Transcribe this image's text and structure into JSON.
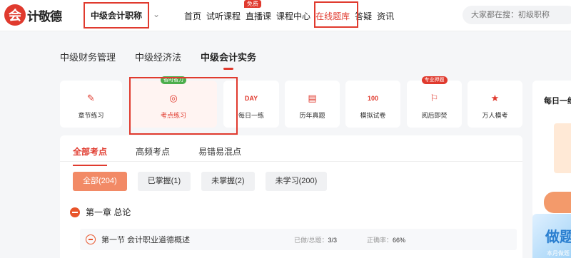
{
  "logo": {
    "mark": "会",
    "text": "计敬德"
  },
  "header": {
    "exam_select": "中级会计职称",
    "nav": [
      "首页",
      "试听课程",
      "直播课",
      "课程中心",
      "在线题库",
      "答疑",
      "资讯"
    ],
    "active_nav": "在线题库",
    "free_badge": "免费",
    "search_placeholder": "大家都在搜：初级职称"
  },
  "subjects": {
    "tabs": [
      "中级财务管理",
      "中级经济法",
      "中级会计实务"
    ],
    "active": "中级会计实务"
  },
  "tools": [
    {
      "label": "章节练习",
      "icon": "pencil-icon"
    },
    {
      "label": "考点练习",
      "icon": "target-icon",
      "badge": "省时省力",
      "badge_color": "#4cae4c",
      "highlight": true
    },
    {
      "label": "每日一练",
      "icon": "calendar-icon"
    },
    {
      "label": "历年真题",
      "icon": "book-icon"
    },
    {
      "label": "模拟试卷",
      "icon": "score-icon"
    },
    {
      "label": "阅后即焚",
      "icon": "fire-icon",
      "badge": "专业押题",
      "badge_color": "#e03a2e"
    },
    {
      "label": "万人模考",
      "icon": "trophy-icon"
    }
  ],
  "side": {
    "title": "每日一练",
    "promo_big": "做题",
    "promo_small": "本月做题"
  },
  "keypoints": {
    "tabs": [
      "全部考点",
      "高频考点",
      "易错易混点"
    ],
    "active": "全部考点",
    "filters": [
      "全部(204)",
      "已掌握(1)",
      "未掌握(2)",
      "未学习(200)"
    ],
    "active_filter": "全部(204)",
    "chapter": "第一章 总论",
    "section": {
      "title": "第一节 会计职业道德概述",
      "done_label": "已做/总题：",
      "done_value": "3/3",
      "rate_label": "正确率：",
      "rate_value": "66%"
    }
  },
  "colors": {
    "accent": "#e03a2e",
    "filter_active": "#f28a66"
  }
}
